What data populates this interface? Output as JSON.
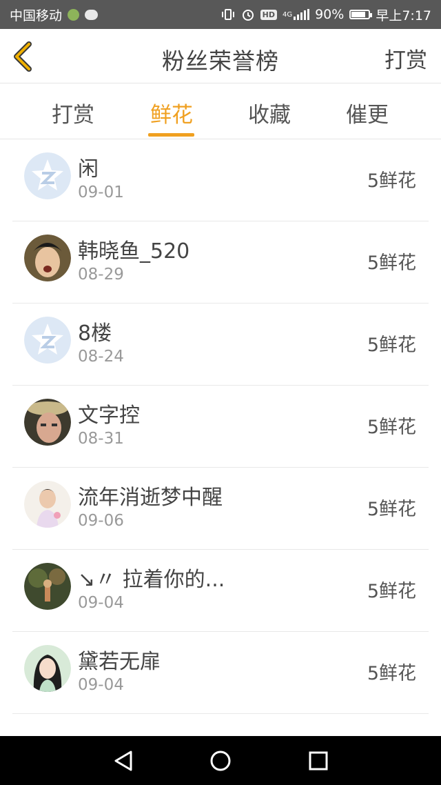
{
  "status_bar": {
    "carrier": "中国移动",
    "battery_percent": "90%",
    "time": "早上7:17",
    "hd_label": "HD",
    "network_label": "4G",
    "battery_level": 0.9
  },
  "header": {
    "title": "粉丝荣誉榜",
    "action_label": "打赏"
  },
  "tabs": [
    {
      "label": "打赏"
    },
    {
      "label": "鲜花"
    },
    {
      "label": "收藏"
    },
    {
      "label": "催更"
    }
  ],
  "active_tab": "鲜花",
  "accent_color": "#f0a020",
  "list": [
    {
      "name": "闲",
      "date": "09-01",
      "value": "5鲜花",
      "avatar": "default-star-avatar"
    },
    {
      "name": "韩晓鱼_520",
      "date": "08-29",
      "value": "5鲜花",
      "avatar": "photo-avatar"
    },
    {
      "name": "8楼",
      "date": "08-24",
      "value": "5鲜花",
      "avatar": "default-star-avatar"
    },
    {
      "name": "文字控",
      "date": "08-31",
      "value": "5鲜花",
      "avatar": "photo-avatar"
    },
    {
      "name": "流年消逝梦中醒",
      "date": "09-06",
      "value": "5鲜花",
      "avatar": "photo-avatar"
    },
    {
      "name": "↘〃 拉着你的...",
      "date": "09-04",
      "value": "5鲜花",
      "avatar": "photo-avatar"
    },
    {
      "name": "黛若无扉",
      "date": "09-04",
      "value": "5鲜花",
      "avatar": "photo-avatar"
    }
  ],
  "nav_bar": {
    "icons": [
      "back-triangle-icon",
      "home-circle-icon",
      "recents-square-icon"
    ]
  }
}
